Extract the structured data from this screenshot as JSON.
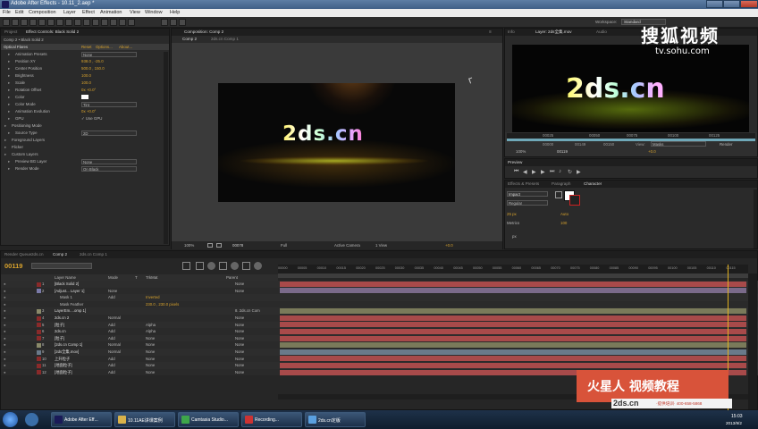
{
  "app": {
    "title": "Adobe After Effects - 10.11_2.aep *"
  },
  "menu": [
    "File",
    "Edit",
    "Composition",
    "Layer",
    "Effect",
    "Animation",
    "View",
    "Window",
    "Help"
  ],
  "workspace": {
    "label": "Workspace:",
    "value": "Standard"
  },
  "left": {
    "tabs": [
      "Project",
      "Effect Controls: Black Solid 2"
    ],
    "sub": "Comp 2 • Black Solid 2",
    "effect": "Optical Flares",
    "links": [
      "Reset",
      "Options...",
      "About..."
    ],
    "props": [
      {
        "n": "Animation Presets",
        "v": "None",
        "t": "menu"
      },
      {
        "n": "Position XY",
        "v": "938.0 , -25.0",
        "t": "num"
      },
      {
        "n": "Center Position",
        "v": "500.0 , 150.0",
        "t": "num"
      },
      {
        "n": "Brightness",
        "v": "100.0",
        "t": "num"
      },
      {
        "n": "Scale",
        "v": "100.0",
        "t": "num"
      },
      {
        "n": "Rotation Offset",
        "v": "0x +0.0°",
        "t": "num"
      },
      {
        "n": "Color",
        "v": "",
        "t": "color"
      },
      {
        "n": "Color Mode",
        "v": "Tint",
        "t": "menu"
      },
      {
        "n": "Animation Evolution",
        "v": "0x +0.0°",
        "t": "num"
      },
      {
        "n": "GPU",
        "v": "Use GPU",
        "t": "check"
      },
      {
        "n": "Positioning Mode",
        "v": "",
        "t": "head"
      },
      {
        "n": "Source Type",
        "v": "2D",
        "t": "menu"
      },
      {
        "n": "Foreground Layers",
        "v": "",
        "t": "head"
      },
      {
        "n": "Flicker",
        "v": "",
        "t": "head"
      },
      {
        "n": "Custom Layers",
        "v": "",
        "t": "head"
      },
      {
        "n": "Preview BG Layer",
        "v": "None",
        "t": "menu"
      },
      {
        "n": "Render Mode",
        "v": "On Black",
        "t": "menu"
      }
    ]
  },
  "comp": {
    "tabs": [
      "Composition: Comp 2"
    ],
    "subtabs": [
      "Comp 2",
      "2ds.cn Comp 1"
    ],
    "title_text": "2ds.cn",
    "footer": [
      "100%",
      "00078",
      "Full",
      "Active Camera",
      "1 View",
      "+0.0"
    ]
  },
  "layerview": {
    "tabs": [
      "Info",
      "Layer: 2ds全集.mov",
      "Audio"
    ],
    "title_text": "2ds.cn",
    "times": [
      "00000",
      "00025",
      "00050",
      "00075",
      "00100",
      "00125"
    ],
    "start": "00000",
    "end": "00149",
    "dur": "00150",
    "view": "View:",
    "viewval": "Masks",
    "render": "Render",
    "zoom": "100%",
    "frame": "00119",
    "exposure": "+0.0"
  },
  "watermark": {
    "sohu": "搜狐视频",
    "url": "tv.sohu.com",
    "brand": "火星人 视频教程",
    "site": "2ds.cn",
    "tag": "·提供培训· 400-658-5868"
  },
  "preview": {
    "label": "Preview"
  },
  "character": {
    "tabs": [
      "Effects & Presets",
      "Paragraph",
      "Character"
    ],
    "font": "Impact",
    "style": "Regular",
    "size": "25 px",
    "leading": "Auto",
    "kerning": "Metrics",
    "tracking": "100",
    "stroke": "px"
  },
  "timeline": {
    "tabs": [
      "Render Queue",
      "2ds.cn",
      "Comp 2",
      "2ds.cn Comp 1"
    ],
    "time": "00119",
    "cols": [
      "Layer Name",
      "Mode",
      "T",
      "TrkMat",
      "Parent"
    ],
    "ruler": [
      "00000",
      "00005",
      "00010",
      "00015",
      "00020",
      "00025",
      "00030",
      "00035",
      "00040",
      "00045",
      "00050",
      "00055",
      "00060",
      "00065",
      "00070",
      "00075",
      "00080",
      "00085",
      "00090",
      "00095",
      "00100",
      "00105",
      "00110",
      "00115"
    ],
    "layers": [
      {
        "num": "1",
        "name": "[Black Solid 2]",
        "mode": "",
        "trk": "",
        "parent": "None",
        "c": "#8a2a2a",
        "bar": "#a84a4a"
      },
      {
        "num": "2",
        "name": "[Adjust... Layer 1]",
        "mode": "None",
        "trk": "",
        "parent": "None",
        "c": "#7a7aa8",
        "bar": "#7a6a8a"
      },
      {
        "num": "",
        "name": "Mask 1",
        "mode": "Add",
        "trk": "Inverted",
        "parent": "",
        "c": "",
        "bar": ""
      },
      {
        "num": "",
        "name": "Mask Feather",
        "mode": "",
        "trk": "230.0 , 230.0 pixels",
        "parent": "",
        "c": "",
        "bar": ""
      },
      {
        "num": "3",
        "name": "LayerEm....omp 1]",
        "mode": "",
        "trk": "",
        "parent": "8. 2ds.cn Com",
        "c": "#8a8a6a",
        "bar": "#7a7a5a"
      },
      {
        "num": "4",
        "name": "2ds.cn 2",
        "mode": "Normal",
        "trk": "",
        "parent": "None",
        "c": "#8a2a2a",
        "bar": "#a84a4a"
      },
      {
        "num": "5",
        "name": "[粒子]",
        "mode": "Add",
        "trk": "Alpha",
        "parent": "None",
        "c": "#8a2a2a",
        "bar": "#a84a4a"
      },
      {
        "num": "6",
        "name": "2ds.cn",
        "mode": "Add",
        "trk": "Alpha",
        "parent": "None",
        "c": "#8a2a2a",
        "bar": "#a84a4a"
      },
      {
        "num": "7",
        "name": "[粒子]",
        "mode": "Add",
        "trk": "None",
        "parent": "None",
        "c": "#8a2a2a",
        "bar": "#a84a4a"
      },
      {
        "num": "8",
        "name": "[2ds.cn Comp 1]",
        "mode": "Normal",
        "trk": "None",
        "parent": "None",
        "c": "#8a8a6a",
        "bar": "#7a7a5a"
      },
      {
        "num": "9",
        "name": "[2ds全集.mov]",
        "mode": "Normal",
        "trk": "None",
        "parent": "None",
        "c": "#6a7a8a",
        "bar": "#6a7a8a"
      },
      {
        "num": "10",
        "name": "上升粒子",
        "mode": "Add",
        "trk": "None",
        "parent": "None",
        "c": "#8a2a2a",
        "bar": "#a84a4a"
      },
      {
        "num": "11",
        "name": "[地面粒子]",
        "mode": "Add",
        "trk": "None",
        "parent": "None",
        "c": "#8a2a2a",
        "bar": "#a84a4a"
      },
      {
        "num": "12",
        "name": "[地面粒子]",
        "mode": "Add",
        "trk": "None",
        "parent": "None",
        "c": "#8a2a2a",
        "bar": "#a84a4a"
      }
    ]
  },
  "taskbar": {
    "items": [
      "Adobe After Eff...",
      "10.11AE讲课案例",
      "Camtasia Studio...",
      "Recording...",
      "2ds.cn定版"
    ],
    "time": "15:03",
    "date": "2013/9/2"
  }
}
